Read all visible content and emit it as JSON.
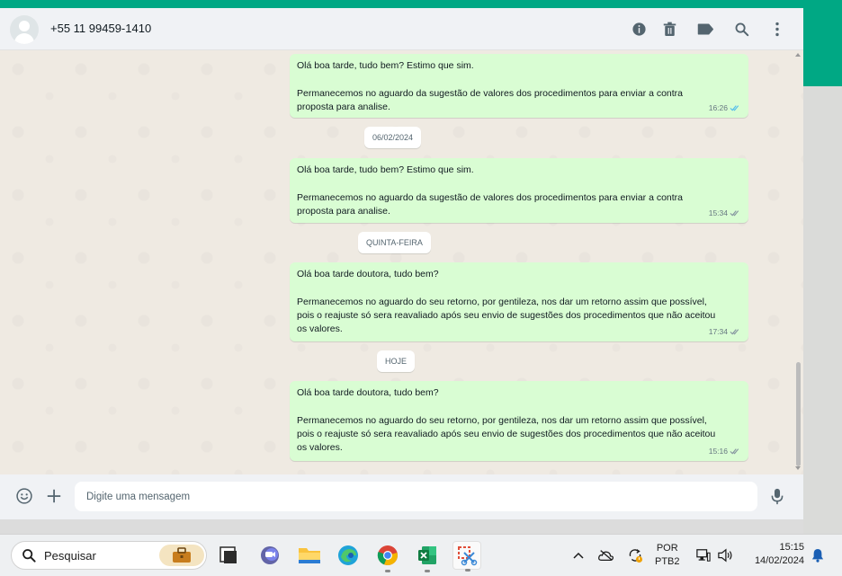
{
  "chat_header": {
    "contact_name": "+55 11 99459-1410",
    "icons": [
      "info-icon",
      "trash-icon",
      "label-icon",
      "search-icon",
      "menu-icon"
    ]
  },
  "messages": [
    {
      "lines": [
        "Olá boa tarde, tudo bem? Estimo que sim.",
        "",
        "Permanecemos no aguardo da sugestão de valores dos procedimentos para enviar a contra",
        "proposta para analise."
      ],
      "time": "16:26",
      "status": "read"
    },
    {
      "lines": [
        "Olá boa tarde, tudo bem? Estimo que sim.",
        "",
        "Permanecemos no aguardo da sugestão de valores dos procedimentos para enviar a contra",
        "proposta para analise."
      ],
      "time": "15:34",
      "status": "delivered"
    },
    {
      "lines": [
        "Olá boa tarde doutora, tudo bem?",
        "",
        "Permanecemos no aguardo do seu retorno, por gentileza, nos dar um retorno assim que possível,",
        "pois o reajuste só sera reavaliado após seu envio de sugestões dos procedimentos que não aceitou",
        "os valores."
      ],
      "time": "17:34",
      "status": "delivered"
    },
    {
      "lines": [
        "Olá boa tarde doutora, tudo bem?",
        "",
        "Permanecemos no aguardo do seu retorno, por gentileza, nos dar um retorno assim que possível,",
        "pois o reajuste só sera reavaliado após seu envio de sugestões dos procedimentos que não aceitou",
        "os valores."
      ],
      "time": "15:16",
      "status": "delivered"
    }
  ],
  "date_separators": [
    "06/02/2024",
    "QUINTA-FEIRA",
    "HOJE"
  ],
  "composer": {
    "placeholder": "Digite uma mensagem"
  },
  "taskbar": {
    "search_label": "Pesquisar",
    "language_line1": "POR",
    "language_line2": "PTB2",
    "time": "15:15",
    "date": "14/02/2024"
  },
  "colors": {
    "accent": "#00a884",
    "bubble_out": "#d9fdd3",
    "read_ticks": "#53bdeb"
  }
}
